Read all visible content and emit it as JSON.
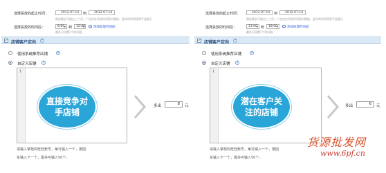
{
  "panels": [
    {
      "date_label": "选择投放的起止时间：",
      "start_date": "2012-07-14",
      "to_word": "到",
      "end_date": "2012-07-14",
      "date_hint": "限定最长不超过三个月，广告仅在所选时间段内播放，此外的时间段将不会展示",
      "time_label": "选择投放的时间段：",
      "start_time": "8:00",
      "time_to": "到",
      "end_time": "12:00",
      "add_time_link": "添加投放时间段",
      "time_hint": "最多可设置3个时间段",
      "section_title": "店铺客户定向",
      "option_system": "使用系统推荐店铺",
      "option_custom": "自定义店铺",
      "line_number": "1",
      "bubble_text": "直接竞争对手店铺",
      "more_label": "多出",
      "more_value": "8",
      "unit": "元",
      "footer_line1": "请输入掌柜的旺旺账号，每行输入一个，按回",
      "footer_line2": "车输入下一个，最多可输入50个。"
    },
    {
      "date_label": "选择投放的起止时间：",
      "start_date": "2012-07-14",
      "to_word": "到",
      "end_date": "2012-07-14",
      "date_hint": "限定最长不超过三个月，广告仅在所选时间段内播放，此外的时间段将不会展示",
      "time_label": "选择投放的时间段：",
      "start_time": "13:00",
      "time_to": "到",
      "end_time": "18:00",
      "add_time_link": "添加投放时间段",
      "time_hint": "最多可设置3个时间段",
      "section_title": "店铺客户定向",
      "option_system": "使用系统推荐店铺",
      "option_custom": "自定义店铺",
      "line_number": "1",
      "bubble_text": "潜在客户关注的店铺",
      "more_label": "多出",
      "more_value": "6",
      "unit": "元",
      "footer_line1": "请输入掌柜的旺旺账号，每行输入一个，按回",
      "footer_line2": "车输入下一个，最多可输入50个。"
    }
  ],
  "watermark": {
    "brand": "货源批发网",
    "url": "www.6pf.cn"
  },
  "colors": {
    "bubble": "#2aa5d8",
    "section_bar": "#dbe9f7",
    "watermark": "#d9532c"
  }
}
